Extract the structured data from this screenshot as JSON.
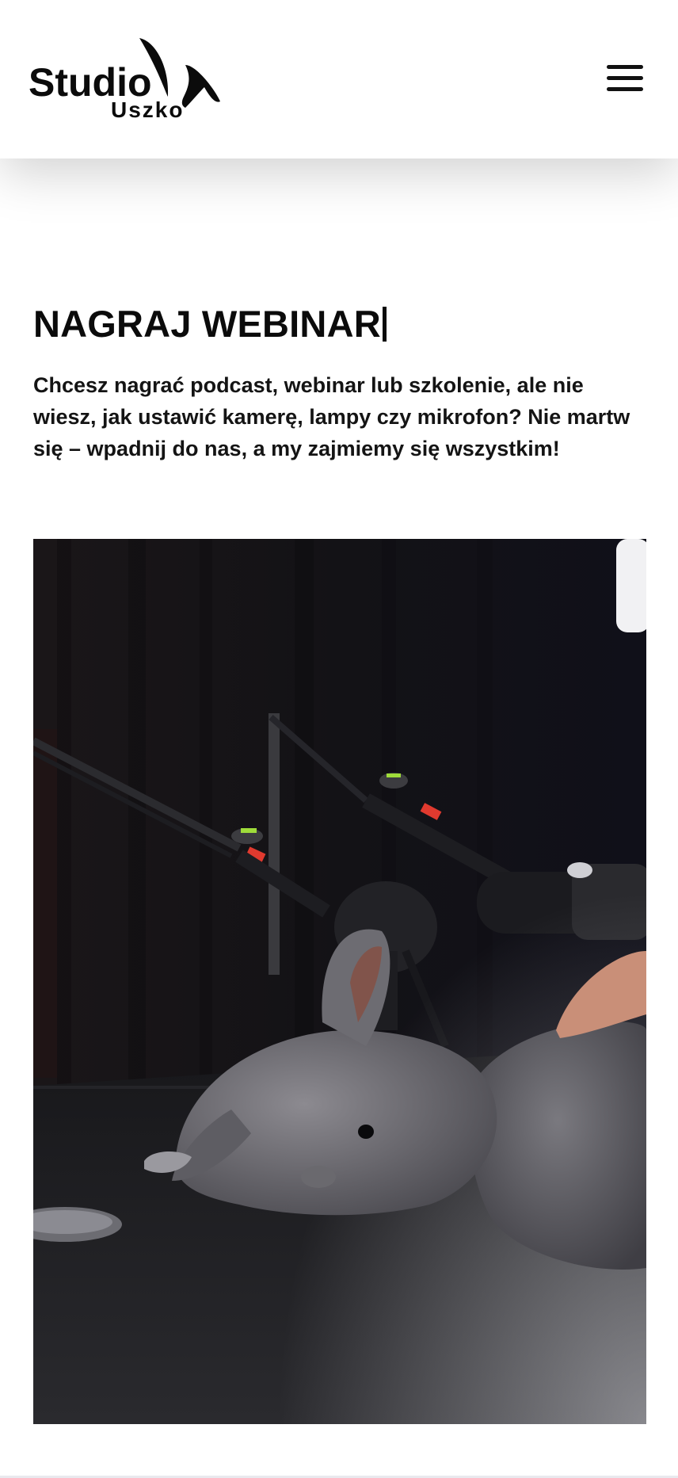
{
  "header": {
    "logo_line1": "Studio",
    "logo_line2": "Uszko",
    "menu_icon": "hamburger-menu-icon"
  },
  "hero": {
    "title": "NAGRAJ WEBINAR",
    "description": "Chcesz nagrać podcast, webinar lub szkolenie, ale nie wiesz, jak ustawić kamerę, lampy czy mikrofon? Nie martw się – wpadnij do nas, a my zajmiemy się wszystkim!"
  },
  "photo": {
    "subject": "rabbit-with-microphones-photo"
  }
}
